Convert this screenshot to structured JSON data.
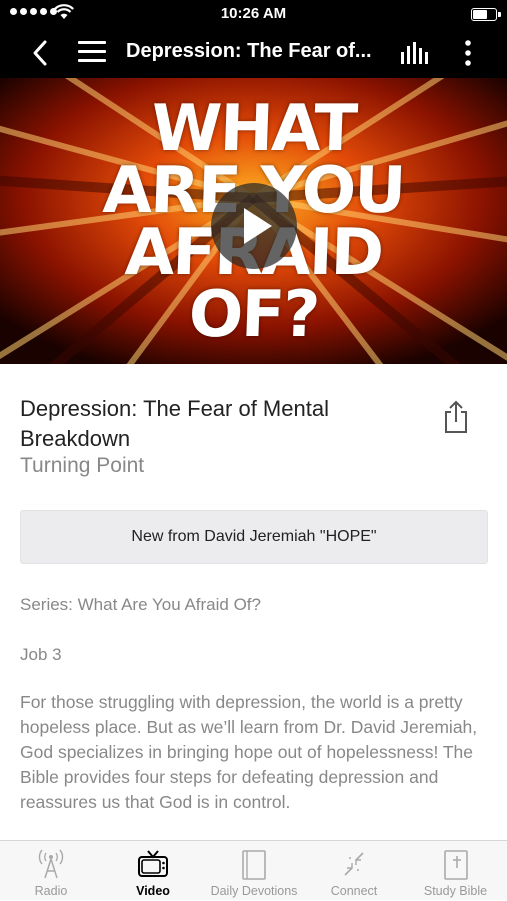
{
  "status_bar": {
    "time": "10:26 AM"
  },
  "nav": {
    "title": "Depression: The Fear of..."
  },
  "video": {
    "art_lines": [
      "WHAT",
      "ARE YOU",
      "AFRAID",
      "OF?"
    ]
  },
  "episode": {
    "title": "Depression: The Fear of Mental Breakdown",
    "publisher": "Turning Point",
    "promo_button": "New from David Jeremiah \"HOPE\"",
    "series": "Series: What Are You Afraid Of?",
    "scripture": "Job 3",
    "description": "For those struggling with depression, the world is a pretty hopeless place. But as we’ll learn from Dr. David Jeremiah, God specializes in bringing hope out of hopelessness! The Bible provides four steps for defeating depression and reassures us that God is in control."
  },
  "tabs": [
    {
      "label": "Radio",
      "icon": "radio-tower-icon",
      "active": false
    },
    {
      "label": "Video",
      "icon": "tv-icon",
      "active": true
    },
    {
      "label": "Daily Devotions",
      "icon": "book-icon",
      "active": false
    },
    {
      "label": "Connect",
      "icon": "connect-icon",
      "active": false
    },
    {
      "label": "Study Bible",
      "icon": "bible-icon",
      "active": false
    }
  ]
}
